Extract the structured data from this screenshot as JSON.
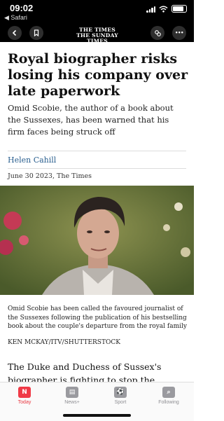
{
  "status": {
    "time": "09:02",
    "back_app": "◀ Safari"
  },
  "nav": {
    "back_icon": "chevron-left-icon",
    "bookmark_icon": "bookmark-icon",
    "masthead_line1": "THE  TIMES",
    "masthead_line2": "THE SUNDAY TIMES",
    "share_icon": "share-icon",
    "more_label": "•••"
  },
  "article": {
    "headline": "Royal biographer risks losing his company over late paperwork",
    "standfirst": "Omid Scobie, the author of a book about the Sussexes, has been warned that his firm faces being struck off",
    "author": "Helen Cahill",
    "dateline": "June 30 2023, The Times",
    "caption": "Omid Scobie has been called the favoured journalist of the Sussexes following the publication of his bestselling book about the couple's departure from the royal family",
    "credit": "KEN MCKAY/ITV/SHUTTERSTOCK",
    "body": "The Duke and Duchess of Sussex's biographer is fighting to stop the dissolution of his com-"
  },
  "tabs": [
    {
      "label": "Today",
      "icon": "news-icon",
      "glyph": "N",
      "active": true
    },
    {
      "label": "News+",
      "icon": "news-plus-icon",
      "glyph": "▤",
      "active": false
    },
    {
      "label": "Sport",
      "icon": "sport-icon",
      "glyph": "⚽",
      "active": false
    },
    {
      "label": "Following",
      "icon": "search-icon",
      "glyph": "⌕",
      "active": false
    }
  ],
  "colors": {
    "accent": "#f03a47",
    "author_link": "#2a5f8f",
    "bar": "#000000"
  }
}
